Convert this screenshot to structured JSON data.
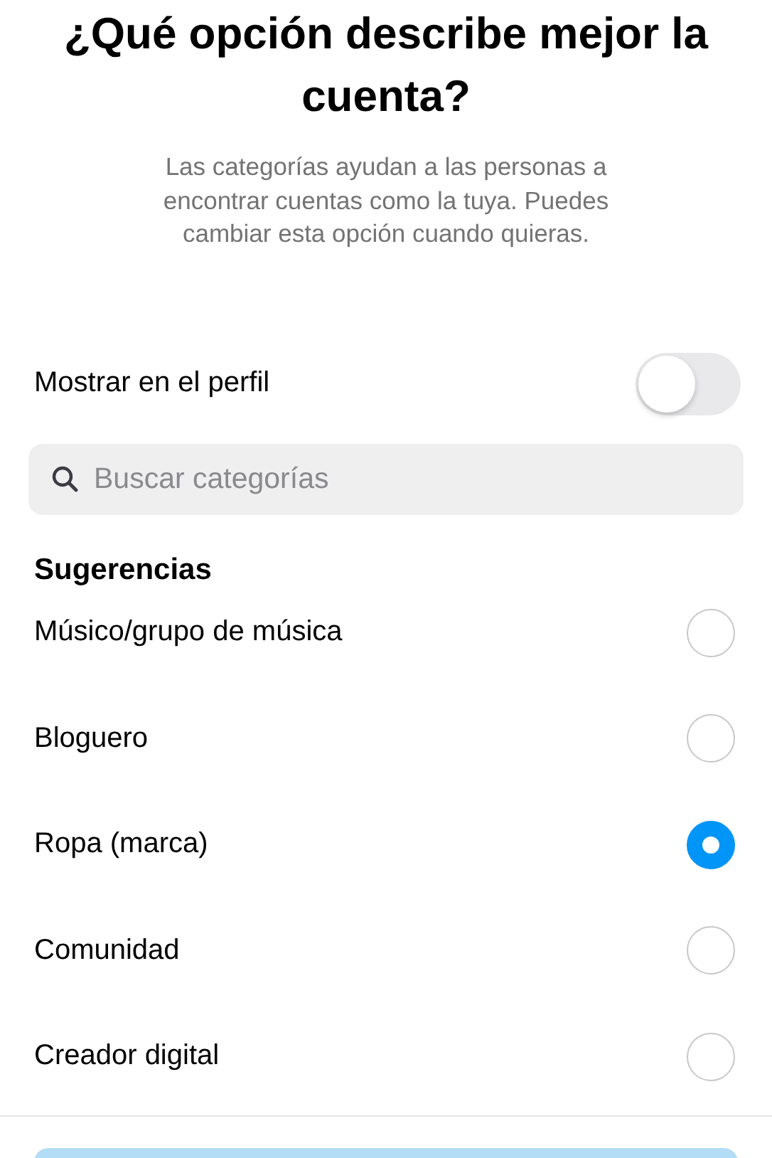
{
  "title": "¿Qué opción describe mejor la cuenta?",
  "subtitle": "Las categorías ayudan a las personas a encontrar cuentas como la tuya. Puedes cambiar esta opción cuando quieras.",
  "profile_toggle": {
    "label": "Mostrar en el perfil",
    "on": false
  },
  "search": {
    "placeholder": "Buscar categorías"
  },
  "section_title": "Sugerencias",
  "categories": [
    {
      "label": "Músico/grupo de música",
      "selected": false
    },
    {
      "label": "Bloguero",
      "selected": false
    },
    {
      "label": "Ropa (marca)",
      "selected": true
    },
    {
      "label": "Comunidad",
      "selected": false
    },
    {
      "label": "Creador digital",
      "selected": false
    }
  ]
}
